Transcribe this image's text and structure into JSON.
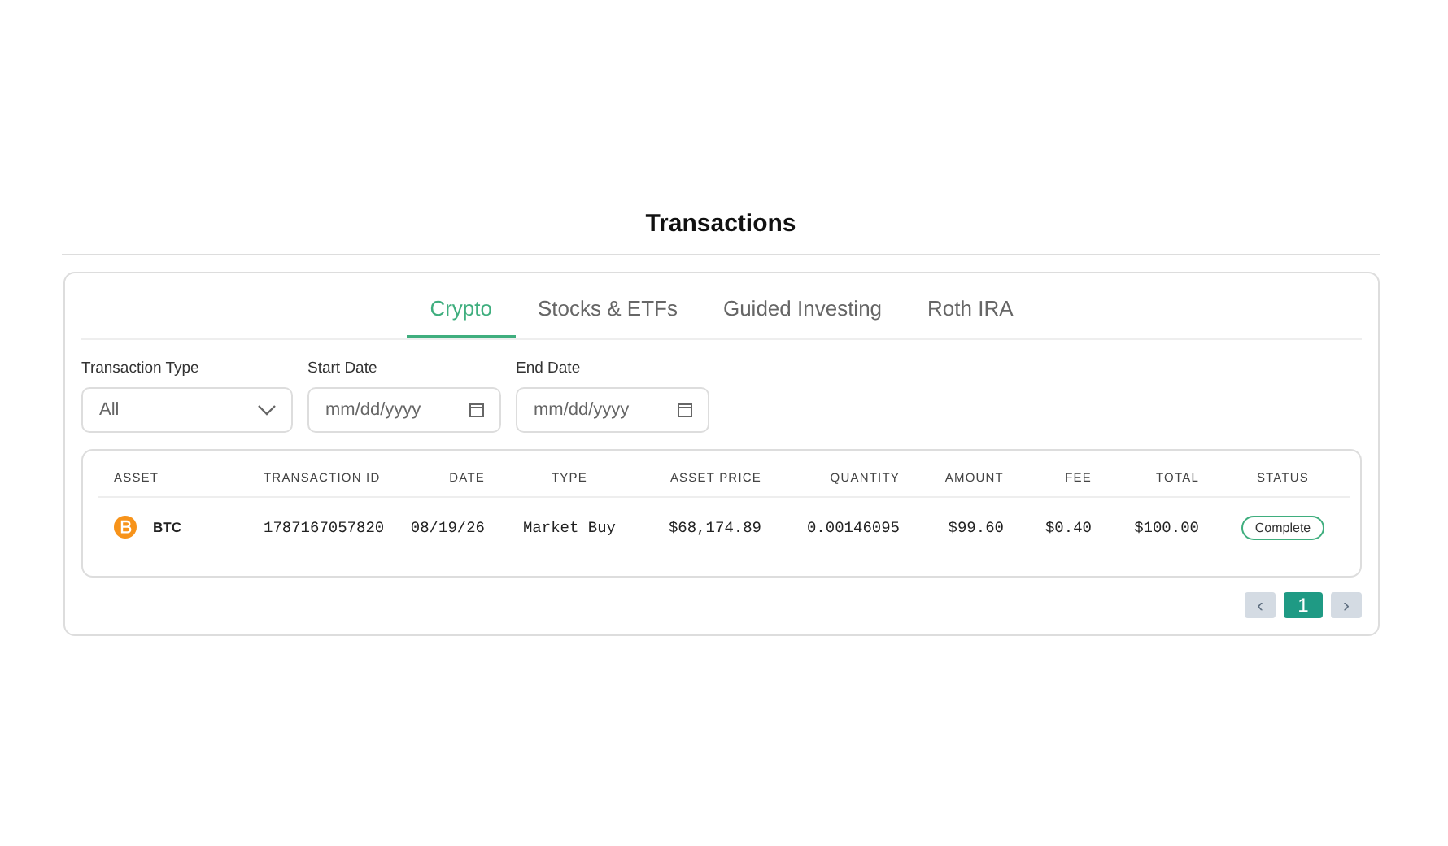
{
  "title": "Transactions",
  "tabs": [
    {
      "label": "Crypto",
      "selected": true
    },
    {
      "label": "Stocks & ETFs",
      "selected": false
    },
    {
      "label": "Guided Investing",
      "selected": false
    },
    {
      "label": "Roth IRA",
      "selected": false
    }
  ],
  "filters": [
    {
      "kind": "select",
      "label": "Transaction Type",
      "value": "All"
    },
    {
      "kind": "date",
      "label": "Start Date",
      "placeholder": "mm/dd/yyyy"
    },
    {
      "kind": "date",
      "label": "End Date",
      "placeholder": "mm/dd/yyyy"
    }
  ],
  "table": {
    "columns": [
      "ASSET",
      "TRANSACTION ID",
      "DATE",
      "TYPE",
      "ASSET PRICE",
      "QUANTITY",
      "AMOUNT",
      "FEE",
      "TOTAL",
      "STATUS"
    ],
    "rows": [
      {
        "asset": "BTC",
        "transaction_id": "1787167057820",
        "date": "08/19/26",
        "type": "Market Buy",
        "asset_price": "$68,174.89",
        "quantity": "0.00146095",
        "amount": "$99.60",
        "fee": "$0.40",
        "total": "$100.00",
        "status": "Complete"
      }
    ]
  },
  "pagination": [
    {
      "kind": "prev",
      "label": "‹",
      "disabled": true
    },
    {
      "kind": "page",
      "label": "1",
      "selected": true
    },
    {
      "kind": "next",
      "label": "›",
      "disabled": true
    }
  ]
}
